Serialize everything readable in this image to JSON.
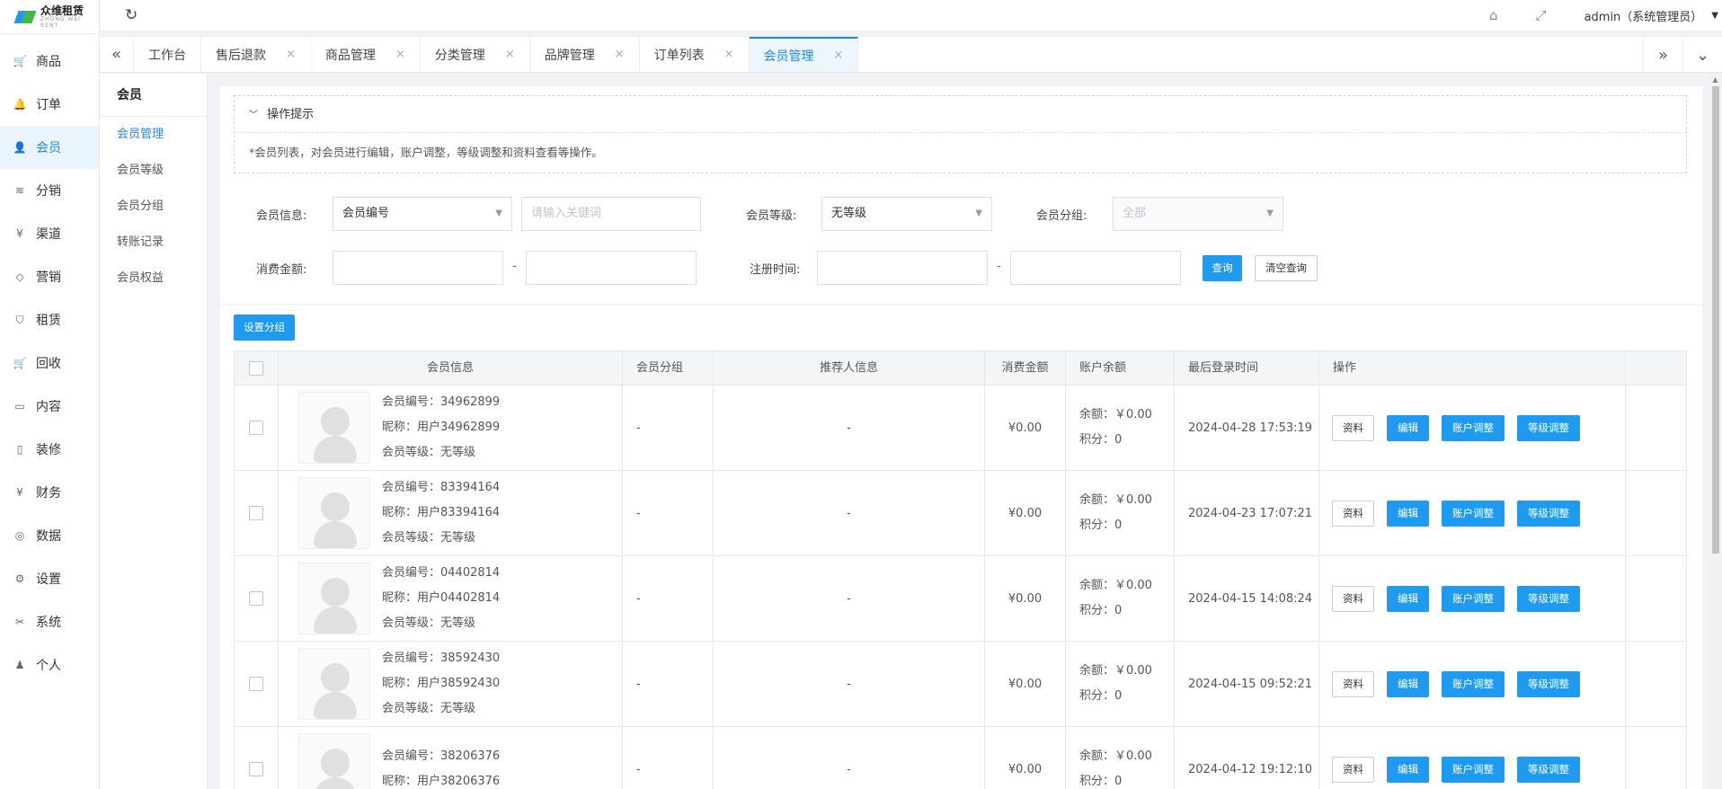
{
  "brand": {
    "name": "众维租赁",
    "sub": "ZHONG WEI RENT"
  },
  "nav": [
    {
      "label": "商品",
      "icon": "cart-icon",
      "glyph": "🛒"
    },
    {
      "label": "订单",
      "icon": "bell-icon",
      "glyph": "🔔"
    },
    {
      "label": "会员",
      "icon": "user-icon",
      "glyph": "👤"
    },
    {
      "label": "分销",
      "icon": "layers-icon",
      "glyph": "≋"
    },
    {
      "label": "渠道",
      "icon": "yen-circle-icon",
      "glyph": "¥"
    },
    {
      "label": "营销",
      "icon": "diamond-icon",
      "glyph": "◇"
    },
    {
      "label": "租赁",
      "icon": "shield-icon",
      "glyph": "⛉"
    },
    {
      "label": "回收",
      "icon": "cart-icon",
      "glyph": "🛒"
    },
    {
      "label": "内容",
      "icon": "book-icon",
      "glyph": "▭"
    },
    {
      "label": "装修",
      "icon": "phone-icon",
      "glyph": "▯"
    },
    {
      "label": "财务",
      "icon": "yen-circle-icon",
      "glyph": "¥"
    },
    {
      "label": "数据",
      "icon": "globe-icon",
      "glyph": "◎"
    },
    {
      "label": "设置",
      "icon": "gear-icon",
      "glyph": "⚙"
    },
    {
      "label": "系统",
      "icon": "tools-icon",
      "glyph": "✂"
    },
    {
      "label": "个人",
      "icon": "person-icon",
      "glyph": "♟"
    }
  ],
  "topbar": {
    "user": "admin（系统管理员）"
  },
  "tabs": [
    {
      "label": "工作台",
      "closable": false
    },
    {
      "label": "售后退款",
      "closable": true
    },
    {
      "label": "商品管理",
      "closable": true
    },
    {
      "label": "分类管理",
      "closable": true
    },
    {
      "label": "品牌管理",
      "closable": true
    },
    {
      "label": "订单列表",
      "closable": true
    },
    {
      "label": "会员管理",
      "closable": true
    }
  ],
  "submenu": {
    "title": "会员",
    "items": [
      "会员管理",
      "会员等级",
      "会员分组",
      "转账记录",
      "会员权益"
    ]
  },
  "tips": {
    "title": "操作提示",
    "text": "*会员列表，对会员进行编辑，账户调整，等级调整和资料查看等操作。"
  },
  "filters": {
    "member_info_label": "会员信息:",
    "member_info_select": "会员编号",
    "keyword_placeholder": "请输入关键词",
    "level_label": "会员等级:",
    "level_select": "无等级",
    "group_label": "会员分组:",
    "group_select": "全部",
    "spend_label": "消费金额:",
    "reg_label": "注册时间:",
    "dash": "-",
    "query_btn": "查询",
    "clear_btn": "清空查询"
  },
  "set_group_btn": "设置分组",
  "table": {
    "headers": [
      "会员信息",
      "会员分组",
      "推荐人信息",
      "消费金额",
      "账户余额",
      "最后登录时间",
      "操作"
    ],
    "rows": [
      {
        "no": "会员编号：34962899",
        "nick": "昵称：用户34962899",
        "level": "会员等级：无等级",
        "group": "-",
        "ref": "-",
        "spend": "¥0.00",
        "balance": "余额：￥0.00",
        "points": "积分：0",
        "login": "2024-04-28 17:53:19"
      },
      {
        "no": "会员编号：83394164",
        "nick": "昵称：用户83394164",
        "level": "会员等级：无等级",
        "group": "-",
        "ref": "-",
        "spend": "¥0.00",
        "balance": "余额：￥0.00",
        "points": "积分：0",
        "login": "2024-04-23 17:07:21"
      },
      {
        "no": "会员编号：04402814",
        "nick": "昵称：用户04402814",
        "level": "会员等级：无等级",
        "group": "-",
        "ref": "-",
        "spend": "¥0.00",
        "balance": "余额：￥0.00",
        "points": "积分：0",
        "login": "2024-04-15 14:08:24"
      },
      {
        "no": "会员编号：38592430",
        "nick": "昵称：用户38592430",
        "level": "会员等级：无等级",
        "group": "-",
        "ref": "-",
        "spend": "¥0.00",
        "balance": "余额：￥0.00",
        "points": "积分：0",
        "login": "2024-04-15 09:52:21"
      },
      {
        "no": "会员编号：38206376",
        "nick": "昵称：用户38206376",
        "level": "",
        "group": "-",
        "ref": "-",
        "spend": "¥0.00",
        "balance": "余额：￥0.00",
        "points": "积分：0",
        "login": "2024-04-12 19:12:10"
      }
    ],
    "ops": [
      "资料",
      "编辑",
      "账户调整",
      "等级调整"
    ]
  },
  "colors": {
    "accent": "#1e88e5",
    "button": "#1e9bf0",
    "active_bg": "#eaf4fd"
  }
}
